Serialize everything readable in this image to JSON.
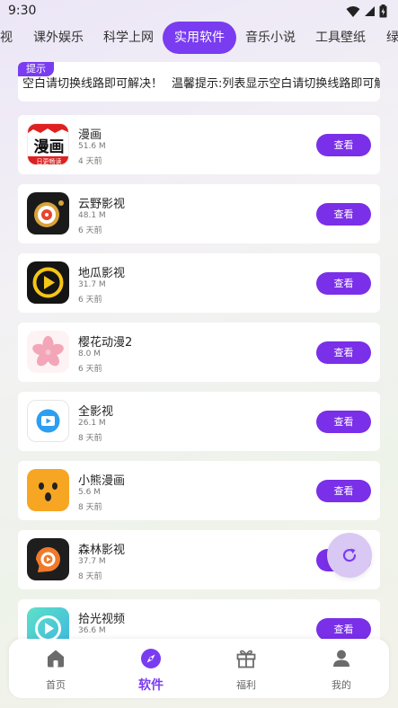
{
  "status": {
    "time": "9:30"
  },
  "tabs": [
    {
      "label": "视"
    },
    {
      "label": "课外娱乐"
    },
    {
      "label": "科学上网"
    },
    {
      "label": "实用软件"
    },
    {
      "label": "音乐小说"
    },
    {
      "label": "工具壁纸"
    },
    {
      "label": "绿"
    }
  ],
  "notice": {
    "tag": "提示",
    "text1": "空白请切换线路即可解决！",
    "text2": "温馨提示:列表显示空白请切换线路即可解"
  },
  "apps": [
    {
      "name": "漫画",
      "size": "51.6 M",
      "time": "4 天前",
      "button": "查看",
      "icon_text": "漫画",
      "icon_sub": "日更畅读"
    },
    {
      "name": "云野影视",
      "size": "48.1 M",
      "time": "6 天前",
      "button": "查看"
    },
    {
      "name": "地瓜影视",
      "size": "31.7 M",
      "time": "6 天前",
      "button": "查看"
    },
    {
      "name": "樱花动漫2",
      "size": "8.0 M",
      "time": "6 天前",
      "button": "查看"
    },
    {
      "name": "全影视",
      "size": "26.1 M",
      "time": "8 天前",
      "button": "查看"
    },
    {
      "name": "小熊漫画",
      "size": "5.6 M",
      "time": "8 天前",
      "button": "查看"
    },
    {
      "name": "森林影视",
      "size": "37.7 M",
      "time": "8 天前",
      "button": "查看"
    },
    {
      "name": "拾光视频",
      "size": "36.6 M",
      "time": "",
      "button": "查看"
    }
  ],
  "nav": [
    {
      "label": "首页",
      "icon": "home-icon"
    },
    {
      "label": "软件",
      "icon": "compass-icon"
    },
    {
      "label": "福利",
      "icon": "gift-icon"
    },
    {
      "label": "我的",
      "icon": "user-icon"
    }
  ],
  "colors": {
    "accent": "#7a3cf0"
  }
}
